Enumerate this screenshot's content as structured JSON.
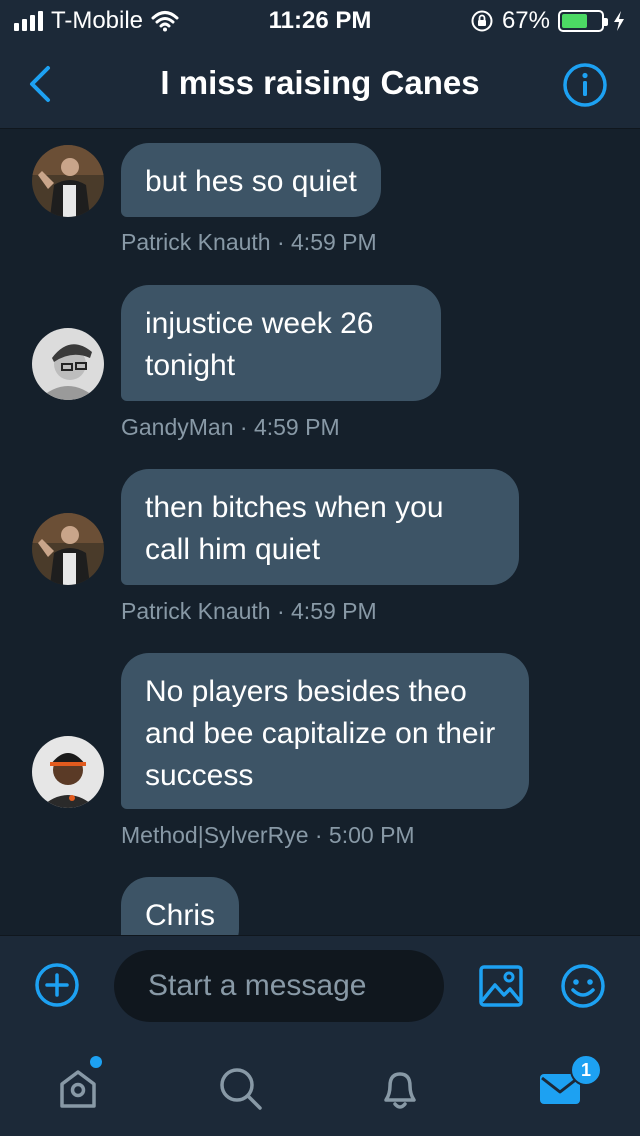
{
  "status_bar": {
    "carrier": "T-Mobile",
    "time": "11:26 PM",
    "battery_percent": "67%",
    "battery_level": 0.67
  },
  "header": {
    "title": "I miss raising Canes"
  },
  "messages": [
    {
      "text": "but hes so quiet",
      "author": "Patrick Knauth",
      "time": "4:59 PM",
      "meta": "Patrick Knauth · 4:59 PM"
    },
    {
      "text": "injustice week 26 tonight",
      "author": "GandyMan",
      "time": "4:59 PM",
      "meta": "GandyMan · 4:59 PM"
    },
    {
      "text": "then bitches when you call him quiet",
      "author": "Patrick Knauth",
      "time": "4:59 PM",
      "meta": "Patrick Knauth · 4:59 PM"
    },
    {
      "text": "No players besides theo and bee capitalize on their success",
      "author": "Method|SylverRye",
      "time": "5:00 PM",
      "meta": "Method|SylverRye · 5:00 PM"
    },
    {
      "text": "Chris"
    }
  ],
  "composer": {
    "placeholder": "Start a message"
  },
  "tabbar": {
    "messages_badge": "1"
  },
  "colors": {
    "accent": "#1da1f2",
    "background": "#15202b",
    "bar": "#1c2938",
    "bubble": "#3d5466",
    "meta_text": "#8899a6",
    "battery": "#4cd964"
  }
}
